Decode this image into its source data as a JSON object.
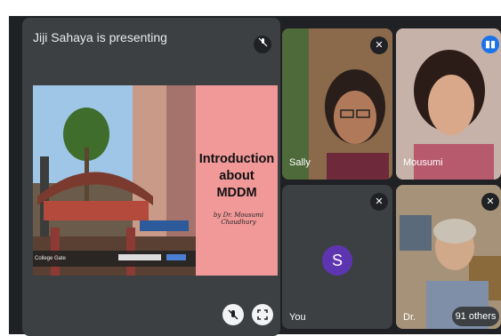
{
  "presenter_banner": "Jiji Sahaya is presenting",
  "slide": {
    "heading_line1": "Introduction",
    "heading_line2": "about",
    "heading_line3": "MDDM",
    "byline": "by Dr. Mousumi Chaudhury",
    "caption": "College Gate"
  },
  "participants": {
    "sally": "Sally",
    "mousumi": "Mousumi",
    "you": "You",
    "you_initial": "S",
    "dr": "Dr."
  },
  "others_count": "91 others",
  "colors": {
    "avatar": "#5e35b1",
    "slide_background": "#f19999",
    "tile": "#3c4043"
  }
}
